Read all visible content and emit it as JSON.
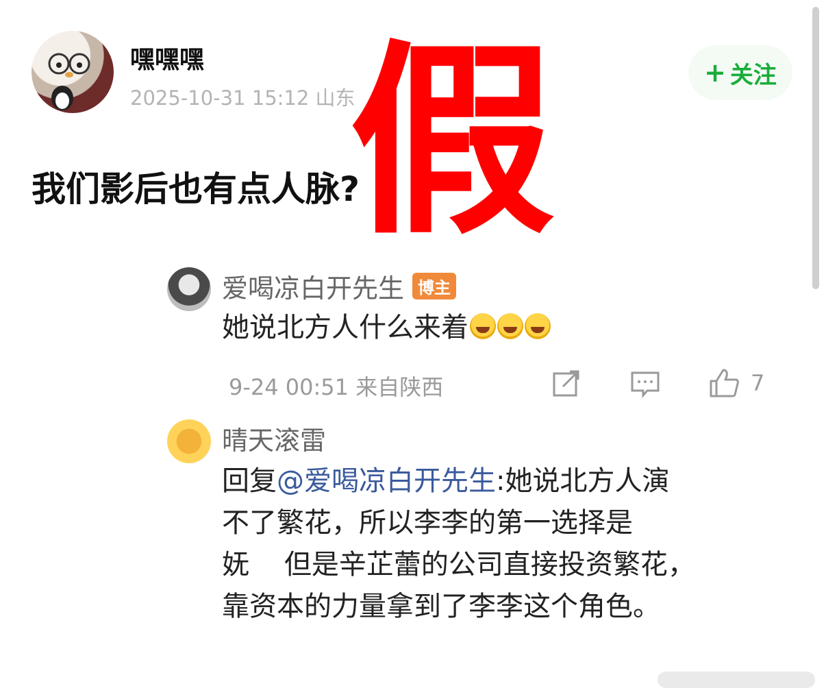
{
  "post": {
    "author": "嘿嘿嘿",
    "meta": "2025-10-31 15:12  山东",
    "follow_label": "关注",
    "text": "我们影后也有点人脉?"
  },
  "stamp": "假",
  "comments": [
    {
      "name": "爱喝凉白开先生",
      "badge": "博主",
      "text": "她说北方人什么来着",
      "emoji": [
        "laugh-cry-emoji",
        "laugh-cry-emoji",
        "laugh-cry-emoji"
      ],
      "time": "9-24 00:51 来自陕西",
      "likes": "7"
    },
    {
      "name": "晴天滚雷",
      "reply_prefix": "回复",
      "mention": "@爱喝凉白开先生",
      "text_lines": [
        ":她说北方人演",
        "不了繁花，所以李李的第一选择是",
        "妩    但是辛芷蕾的公司直接投资繁花，",
        "靠资本的力量拿到了李李这个角色。"
      ]
    }
  ],
  "colors": {
    "accent_green": "#1aad3a",
    "stamp_red": "#ff0000",
    "badge_orange": "#f08a3a",
    "mention_blue": "#3a5a9c"
  }
}
